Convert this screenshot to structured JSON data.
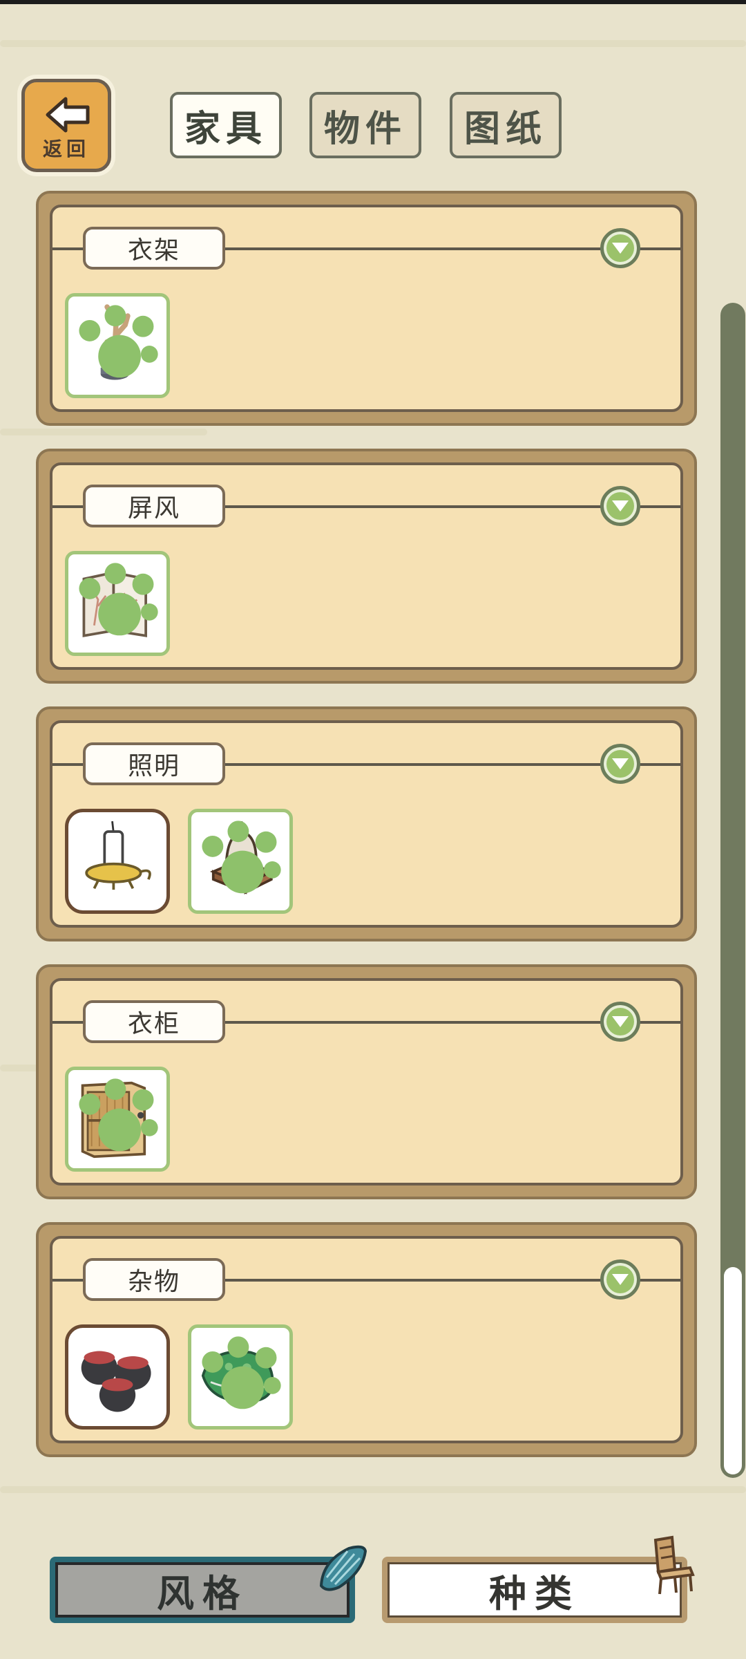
{
  "header": {
    "back_label": "返回",
    "tabs": [
      {
        "label": "家具",
        "active": true
      },
      {
        "label": "物件",
        "active": false
      },
      {
        "label": "图纸",
        "active": false
      }
    ]
  },
  "sections": [
    {
      "title": "衣架",
      "items": [
        {
          "name": "branch-coat-rack-icon",
          "owned": false,
          "has_paw": true
        }
      ]
    },
    {
      "title": "屏风",
      "items": [
        {
          "name": "folding-screen-icon",
          "owned": false,
          "has_paw": true
        }
      ]
    },
    {
      "title": "照明",
      "items": [
        {
          "name": "candle-holder-icon",
          "owned": true,
          "has_paw": false
        },
        {
          "name": "paper-lantern-icon",
          "owned": false,
          "has_paw": true
        }
      ]
    },
    {
      "title": "衣柜",
      "items": [
        {
          "name": "wooden-wardrobe-icon",
          "owned": false,
          "has_paw": true
        }
      ]
    },
    {
      "title": "杂物",
      "items": [
        {
          "name": "clay-jars-icon",
          "owned": true,
          "has_paw": false
        },
        {
          "name": "frog-stone-icon",
          "owned": false,
          "has_paw": true
        }
      ]
    }
  ],
  "bottom": {
    "style_label": "风格",
    "type_label": "种类"
  },
  "colors": {
    "background": "#e8e3cc",
    "section_frame": "#b89a6a",
    "section_panel": "#f6e1b4",
    "accent_green": "#9bc26a",
    "scrollbar": "#717a5f"
  }
}
